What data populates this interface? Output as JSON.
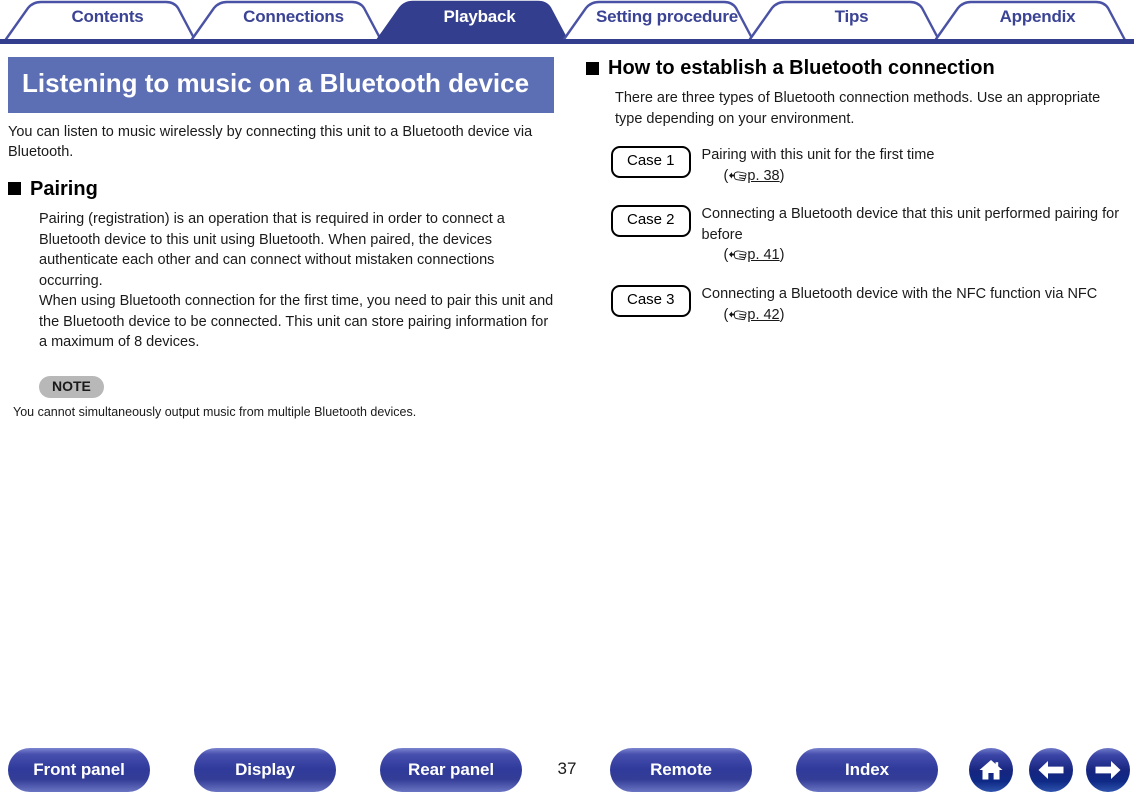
{
  "tabs": [
    {
      "label": "Contents",
      "active": false
    },
    {
      "label": "Connections",
      "active": false
    },
    {
      "label": "Playback",
      "active": true
    },
    {
      "label": "Setting procedure",
      "active": false
    },
    {
      "label": "Tips",
      "active": false
    },
    {
      "label": "Appendix",
      "active": false
    }
  ],
  "colors": {
    "tab_active_fill": "#343e8e",
    "tab_inactive_text": "#3b4395",
    "tab_underline": "#343e8e",
    "chapter_banner_bg": "#5c6fb4",
    "note_badge_bg": "#b8b8b8",
    "footer_button": "#2f3a9b"
  },
  "left_column": {
    "chapter_title": "Listening to music on a Bluetooth device",
    "intro": "You can listen to music wirelessly by connecting this unit to a Bluetooth device via Bluetooth.",
    "section": {
      "heading": "Pairing",
      "paragraphs": [
        "Pairing (registration) is an operation that is required in order to connect a Bluetooth device to this unit using Bluetooth. When paired, the devices authenticate each other and can connect without mistaken connections occurring.",
        "When using Bluetooth connection for the first time, you need to pair this unit and the Bluetooth device to be connected. This unit can store pairing information for a maximum of 8 devices."
      ]
    },
    "note": {
      "badge": "NOTE",
      "text": "You cannot simultaneously output music from multiple Bluetooth devices."
    }
  },
  "right_column": {
    "section": {
      "heading": "How to establish a Bluetooth connection",
      "intro": "There are three types of Bluetooth connection methods. Use an appropriate type depending on your environment."
    },
    "cases": [
      {
        "chip": "Case 1",
        "description": "Pairing with this unit for the first time",
        "ref_open": "(",
        "ref_link": "p. 38",
        "ref_close": ")"
      },
      {
        "chip": "Case 2",
        "description": "Connecting a Bluetooth device that this unit performed pairing for before",
        "ref_open": "(",
        "ref_link": "p. 41",
        "ref_close": ")"
      },
      {
        "chip": "Case 3",
        "description": "Connecting a Bluetooth device with the NFC function via NFC",
        "ref_open": "(",
        "ref_link": "p. 42",
        "ref_close": ")"
      }
    ]
  },
  "footer": {
    "buttons": [
      {
        "label": "Front panel"
      },
      {
        "label": "Display"
      },
      {
        "label": "Rear panel"
      },
      {
        "label": "Remote"
      },
      {
        "label": "Index"
      }
    ],
    "page_number": "37",
    "circles": [
      {
        "icon": "home-icon"
      },
      {
        "icon": "arrow-left-icon"
      },
      {
        "icon": "arrow-right-icon"
      }
    ]
  }
}
